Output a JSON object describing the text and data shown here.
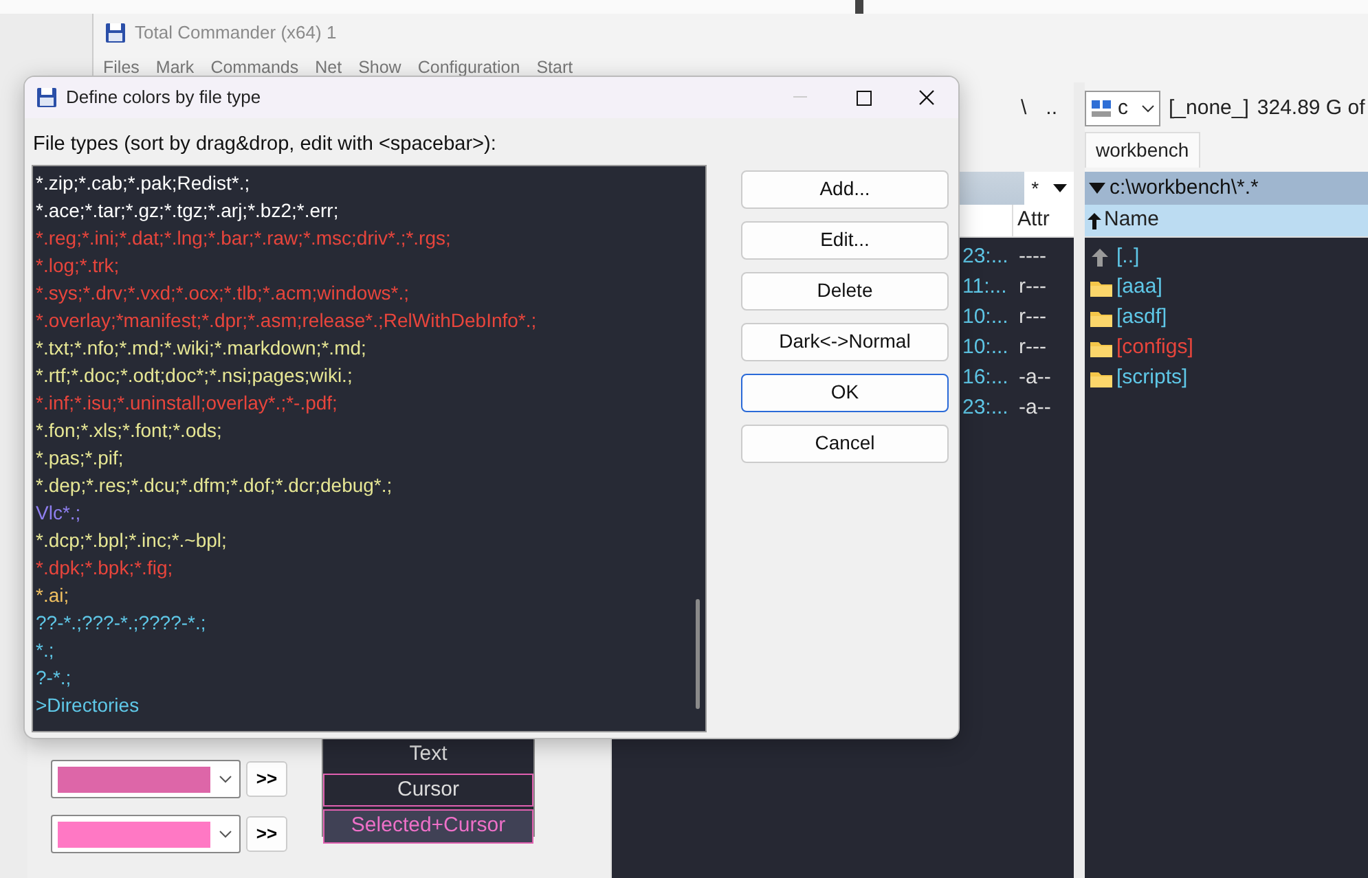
{
  "main_window": {
    "title": "Total Commander (x64) 1",
    "menu": [
      "Files",
      "Mark",
      "Commands",
      "Net",
      "Show",
      "Configuration",
      "Start"
    ]
  },
  "left_panel": {
    "drive_bar": [
      "\\",
      ".."
    ],
    "filter": "*",
    "columns": [
      "Attr"
    ],
    "rows": [
      {
        "time": "23:...",
        "attr": "----"
      },
      {
        "time": "11:...",
        "attr": "r---"
      },
      {
        "time": "10:...",
        "attr": "r---"
      },
      {
        "time": "10:...",
        "attr": "r---"
      },
      {
        "time": "16:...",
        "attr": "-a--"
      },
      {
        "time": "23:...",
        "attr": "-a--"
      }
    ]
  },
  "right_panel": {
    "drive": "c",
    "drive_label": "[_none_]",
    "free_space": "324.89 G of",
    "tab": "workbench",
    "path": "c:\\workbench\\*.*",
    "columns": [
      "Name"
    ],
    "rows": [
      {
        "kind": "up",
        "name": "[..]",
        "color": "#5fc8e8"
      },
      {
        "kind": "folder",
        "name": "[aaa]",
        "color": "#5fc8e8"
      },
      {
        "kind": "folder",
        "name": "[asdf]",
        "color": "#5fc8e8"
      },
      {
        "kind": "folder",
        "name": "[configs]",
        "color": "#e8453c"
      },
      {
        "kind": "folder",
        "name": "[scripts]",
        "color": "#5fc8e8"
      }
    ]
  },
  "color_dialog": {
    "swatches": [
      {
        "color": "#dd66a8",
        "button": ">>"
      },
      {
        "color": "#ff78c4",
        "button": ">>"
      }
    ],
    "preview": [
      {
        "kind": "text",
        "label": "Text"
      },
      {
        "kind": "cursor",
        "label": "Cursor"
      },
      {
        "kind": "selected_cursor",
        "label": "Selected+Cursor"
      }
    ]
  },
  "dialog": {
    "title": "Define colors by file type",
    "label": "File types (sort by drag&drop, edit with <spacebar>):",
    "file_types": [
      {
        "text": "*.zip;*.cab;*.pak;Redist*.;",
        "color": "#ffffff"
      },
      {
        "text": "*.ace;*.tar;*.gz;*.tgz;*.arj;*.bz2;*.err;",
        "color": "#ffffff"
      },
      {
        "text": "*.reg;*.ini;*.dat;*.lng;*.bar;*.raw;*.msc;driv*.;*.rgs;",
        "color": "#e8453c"
      },
      {
        "text": "*.log;*.trk;",
        "color": "#e8453c"
      },
      {
        "text": "*.sys;*.drv;*.vxd;*.ocx;*.tlb;*.acm;windows*.;",
        "color": "#e8453c"
      },
      {
        "text": "*.overlay;*manifest;*.dpr;*.asm;release*.;RelWithDebInfo*.;",
        "color": "#e8453c"
      },
      {
        "text": "*.txt;*.nfo;*.md;*.wiki;*.markdown;*.md;",
        "color": "#e6e694"
      },
      {
        "text": "*.rtf;*.doc;*.odt;doc*;*.nsi;pages;wiki.;",
        "color": "#e6e694"
      },
      {
        "text": "*.inf;*.isu;*.uninstall;overlay*.;*-.pdf;",
        "color": "#e8453c"
      },
      {
        "text": "*.fon;*.xls;*.font;*.ods;",
        "color": "#e6e694"
      },
      {
        "text": "*.pas;*.pif;",
        "color": "#e6e694"
      },
      {
        "text": "*.dep;*.res;*.dcu;*.dfm;*.dof;*.dcr;debug*.;",
        "color": "#e6e694"
      },
      {
        "text": "Vlc*.;",
        "color": "#8f7ff0"
      },
      {
        "text": "*.dcp;*.bpl;*.inc;*.~bpl;",
        "color": "#e6e694"
      },
      {
        "text": "*.dpk;*.bpk;*.fig;",
        "color": "#e8453c"
      },
      {
        "text": "*.ai;",
        "color": "#f0c060"
      },
      {
        "text": "??-*.;???-*.;????-*.;",
        "color": "#5fc8e8"
      },
      {
        "text": "*.;",
        "color": "#5fc8e8"
      },
      {
        "text": "?-*.;",
        "color": "#5fc8e8"
      },
      {
        "text": ">Directories",
        "color": "#5fc8e8"
      }
    ],
    "buttons": [
      {
        "label": "Add...",
        "default": false
      },
      {
        "label": "Edit...",
        "default": false
      },
      {
        "label": "Delete",
        "default": false
      },
      {
        "label": "Dark<->Normal",
        "default": false
      },
      {
        "label": "OK",
        "default": true
      },
      {
        "label": "Cancel",
        "default": false
      }
    ]
  }
}
